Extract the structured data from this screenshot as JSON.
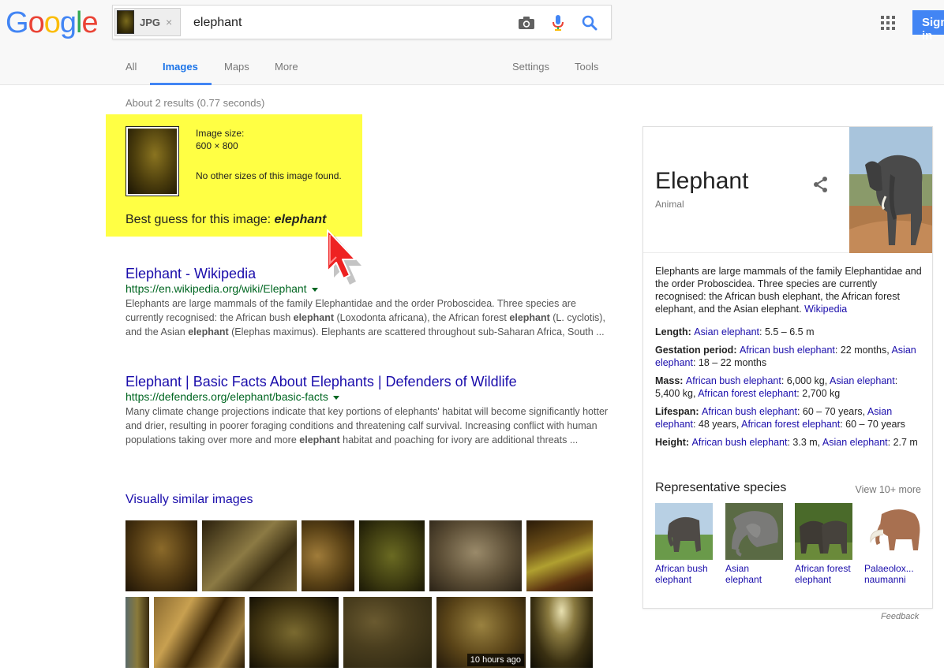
{
  "colors": {
    "link": "#1a0dab",
    "url_green": "#006621",
    "highlight": "#ffff44",
    "accent_blue": "#4285f4"
  },
  "logo": [
    "G",
    "o",
    "o",
    "g",
    "l",
    "e"
  ],
  "search": {
    "chip_label": "JPG",
    "chip_close": "×",
    "query": "elephant",
    "camera_icon": "camera-icon",
    "mic_icon": "mic-icon",
    "search_icon": "search-icon"
  },
  "header_right": {
    "apps_icon": "apps-grid-icon",
    "signin": "Sign in"
  },
  "tabs": {
    "all": "All",
    "images": "Images",
    "maps": "Maps",
    "more": "More",
    "settings": "Settings",
    "tools": "Tools"
  },
  "stats": "About 2 results (0.77 seconds)",
  "best_guess": {
    "size_label": "Image size:",
    "size": "600 × 800",
    "note": "No other sizes of this image found.",
    "prefix": "Best guess for this image:",
    "guess": "elephant"
  },
  "results": [
    {
      "title": "Elephant - Wikipedia",
      "url": "https://en.wikipedia.org/wiki/Elephant",
      "snippet": [
        {
          "t": "Elephants are large mammals of the family Elephantidae and the order Proboscidea. Three species are currently recognised: the African bush ",
          "b": false
        },
        {
          "t": "elephant",
          "b": true
        },
        {
          "t": " (Loxodonta africana), the African forest ",
          "b": false
        },
        {
          "t": "elephant",
          "b": true
        },
        {
          "t": " (L. cyclotis), and the Asian ",
          "b": false
        },
        {
          "t": "elephant",
          "b": true
        },
        {
          "t": " (Elephas maximus). Elephants are scattered throughout sub-Saharan Africa, South ...",
          "b": false
        }
      ]
    },
    {
      "title": "Elephant | Basic Facts About Elephants | Defenders of Wildlife",
      "url": "https://defenders.org/elephant/basic-facts",
      "snippet": [
        {
          "t": "Many climate change projections indicate that key portions of elephants' habitat will become significantly hotter and drier, resulting in poorer foraging conditions and threatening calf survival. Increasing conflict with human populations taking over more and more ",
          "b": false
        },
        {
          "t": "elephant",
          "b": true
        },
        {
          "t": " habitat and poaching for ivory are additional threats ...",
          "b": false
        }
      ]
    }
  ],
  "visually_similar": {
    "title": "Visually similar images",
    "badge": "10 hours ago"
  },
  "knowledge_panel": {
    "title": "Elephant",
    "subtitle": "Animal",
    "description": "Elephants are large mammals of the family Elephantidae and the order Proboscidea. Three species are currently recognised: the African bush elephant, the African forest elephant, and the Asian elephant.",
    "source": "Wikipedia",
    "facts": [
      {
        "label": "Length:",
        "parts": [
          {
            "t": "Asian elephant",
            "link": true
          },
          {
            "t": ": 5.5 – 6.5 m",
            "link": false
          }
        ]
      },
      {
        "label": "Gestation period:",
        "parts": [
          {
            "t": "African bush elephant",
            "link": true
          },
          {
            "t": ": 22 months, ",
            "link": false
          },
          {
            "t": "Asian elephant",
            "link": true
          },
          {
            "t": ": 18 – 22 months",
            "link": false
          }
        ]
      },
      {
        "label": "Mass:",
        "parts": [
          {
            "t": "African bush elephant",
            "link": true
          },
          {
            "t": ": 6,000 kg, ",
            "link": false
          },
          {
            "t": "Asian elephant",
            "link": true
          },
          {
            "t": ": 5,400 kg, ",
            "link": false
          },
          {
            "t": "African forest elephant",
            "link": true
          },
          {
            "t": ": 2,700 kg",
            "link": false
          }
        ]
      },
      {
        "label": "Lifespan:",
        "parts": [
          {
            "t": "African bush elephant",
            "link": true
          },
          {
            "t": ": 60 – 70 years, ",
            "link": false
          },
          {
            "t": "Asian elephant",
            "link": true
          },
          {
            "t": ": 48 years, ",
            "link": false
          },
          {
            "t": "African forest elephant",
            "link": true
          },
          {
            "t": ": 60 – 70 years",
            "link": false
          }
        ]
      },
      {
        "label": "Height:",
        "parts": [
          {
            "t": "African bush elephant",
            "link": true
          },
          {
            "t": ": 3.3 m, ",
            "link": false
          },
          {
            "t": "Asian elephant",
            "link": true
          },
          {
            "t": ": 2.7 m",
            "link": false
          }
        ]
      }
    ],
    "rep_title": "Representative species",
    "rep_more": "View 10+ more",
    "species": [
      {
        "label": "African bush elephant"
      },
      {
        "label": "Asian elephant"
      },
      {
        "label": "African forest elephant"
      },
      {
        "label": "Palaeolox... naumanni"
      }
    ],
    "feedback": "Feedback"
  }
}
